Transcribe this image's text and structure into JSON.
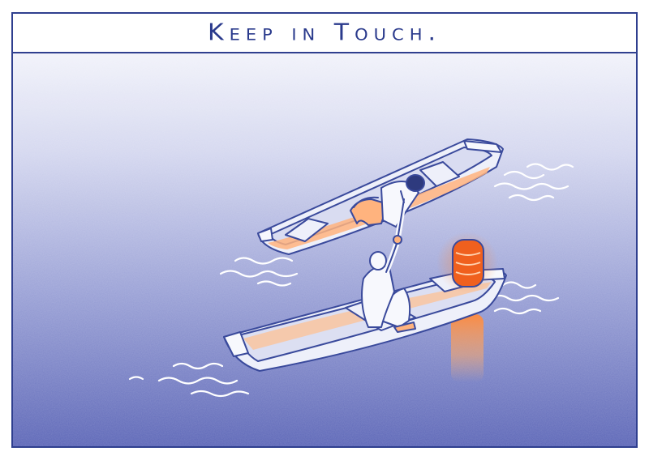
{
  "caption": {
    "text": "Keep in Touch."
  },
  "colors": {
    "frame": "#2f3f8f",
    "sky_top": "#eceef8",
    "water_bottom": "#5a63b4",
    "boat_fill": "#eef0fa",
    "boat_line": "#3a4a9c",
    "lantern": "#f0601e",
    "glow": "#ff9a55"
  },
  "icons": {
    "upper_boat": "rowboat-icon",
    "lower_boat": "rowboat-icon",
    "lantern": "paper-lantern-icon"
  }
}
